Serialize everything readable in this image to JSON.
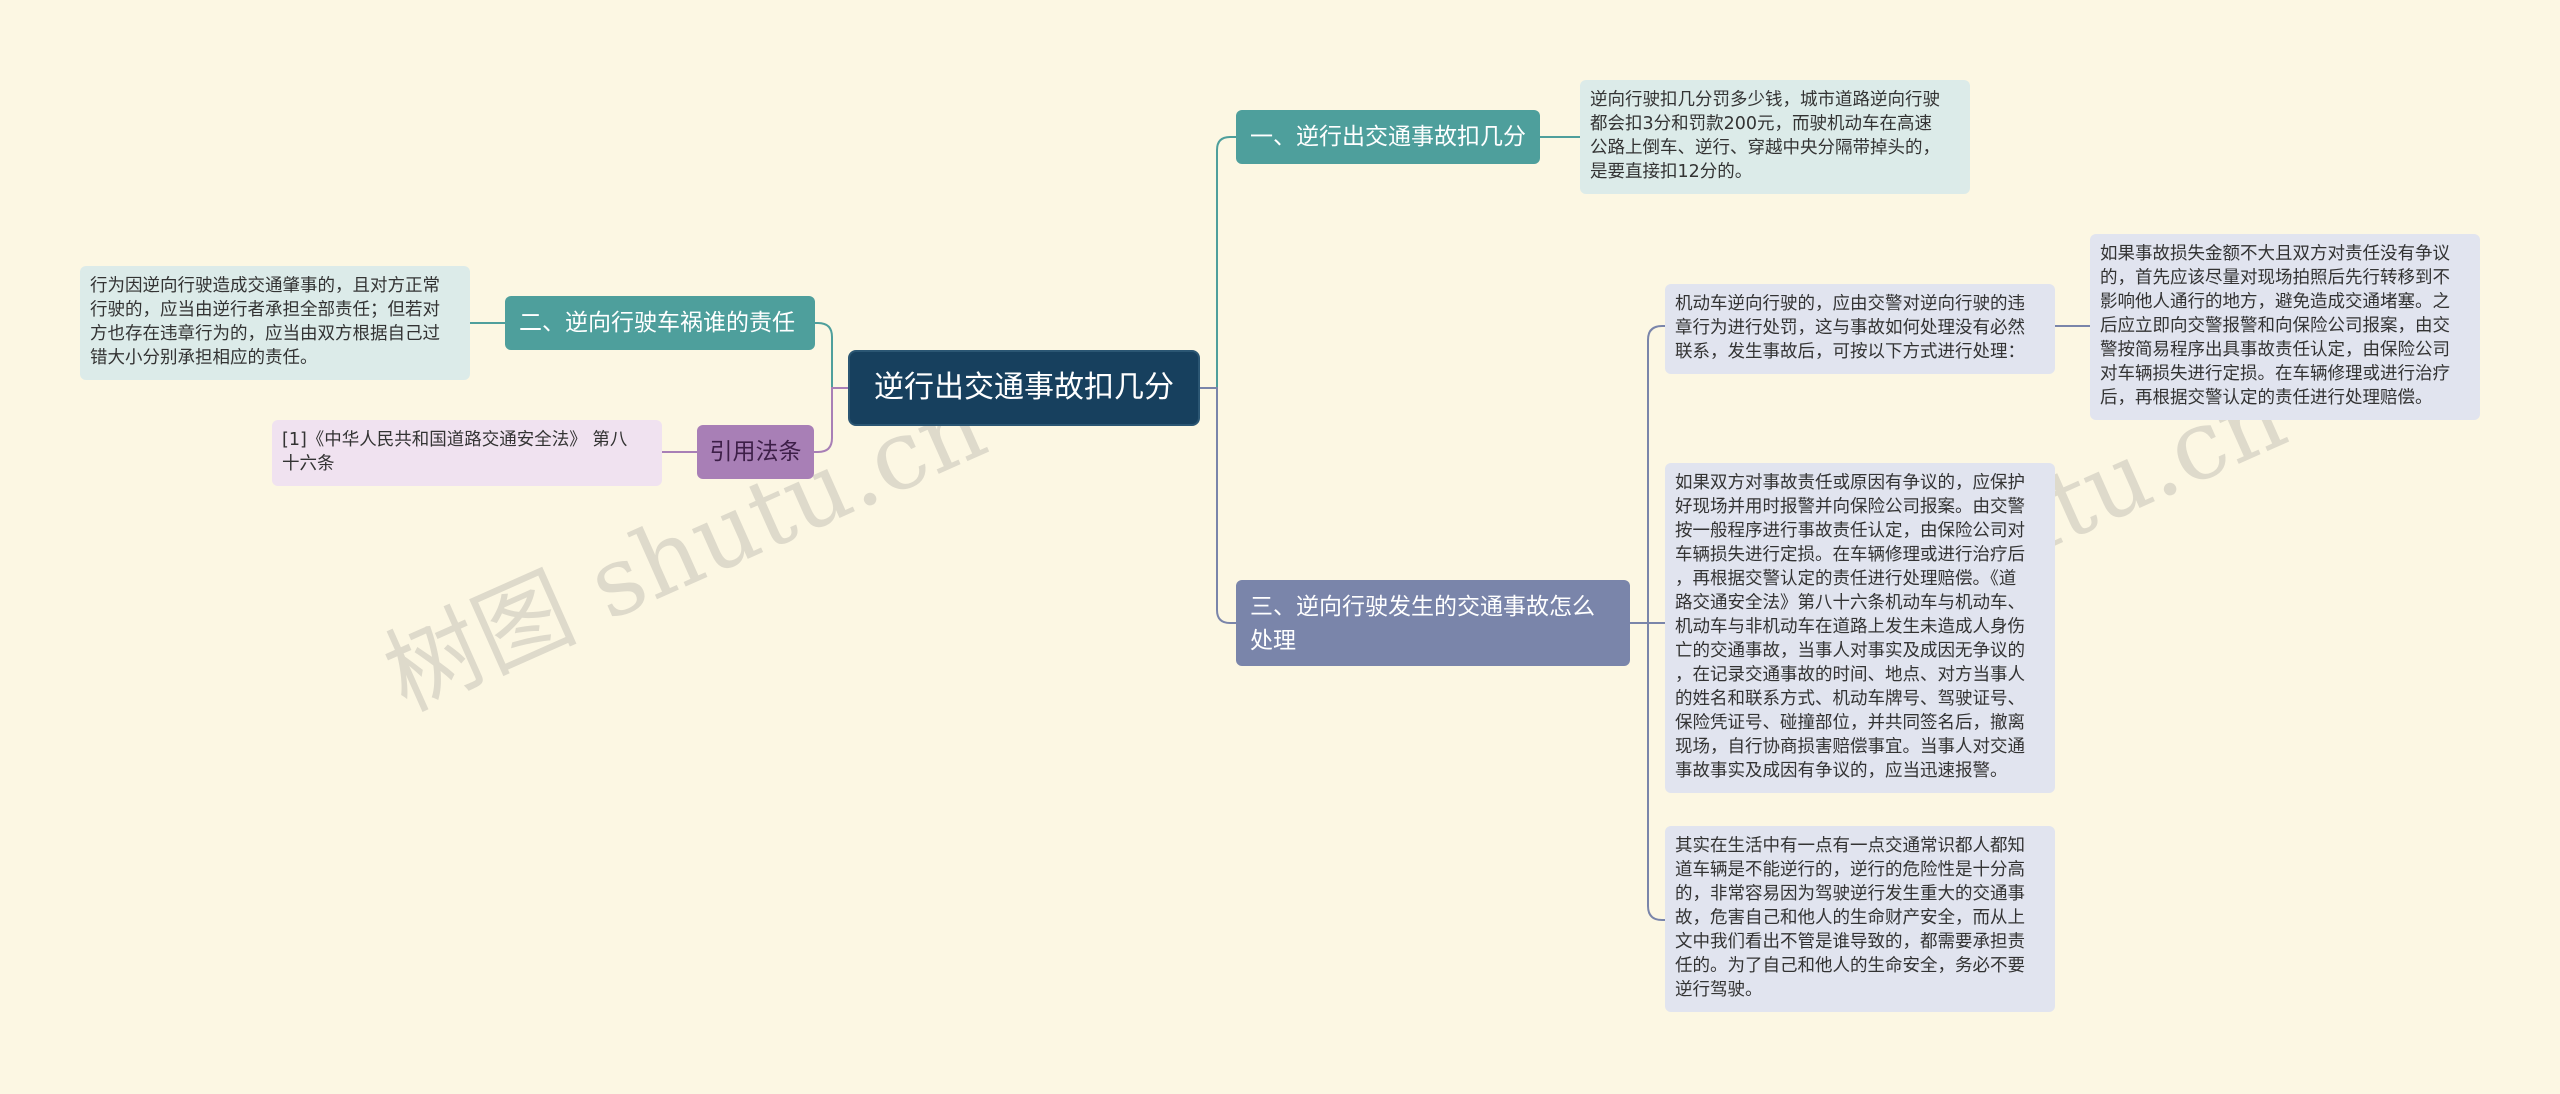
{
  "root": {
    "label": "逆行出交通事故扣几分"
  },
  "branches": {
    "b1": {
      "label": "一、逆行出交通事故扣几分"
    },
    "b2": {
      "label": "二、逆向行驶车祸谁的责任"
    },
    "b3": {
      "label": "三、逆向行驶发生的交通事故怎么\n处理"
    },
    "b4": {
      "label": "引用法条"
    }
  },
  "leaves": {
    "l1": {
      "text": "逆向行驶扣几分罚多少钱，城市道路逆向行驶\n都会扣3分和罚款200元，而驶机动车在高速\n公路上倒车、逆行、穿越中央分隔带掉头的，\n是要直接扣12分的。"
    },
    "l2": {
      "text": "行为因逆向行驶造成交通肇事的，且对方正常\n行驶的，应当由逆行者承担全部责任；但若对\n方也存在违章行为的，应当由双方根据自己过\n错大小分别承担相应的责任。"
    },
    "l3": {
      "text": "[1]《中华人民共和国道路交通安全法》 第八\n十六条"
    },
    "l4": {
      "text": "机动车逆向行驶的，应由交警对逆向行驶的违\n章行为进行处罚，这与事故如何处理没有必然\n联系，发生事故后，可按以下方式进行处理："
    },
    "l5": {
      "text": "如果事故损失金额不大且双方对责任没有争议\n的，首先应该尽量对现场拍照后先行转移到不\n影响他人通行的地方，避免造成交通堵塞。之\n后应立即向交警报警和向保险公司报案，由交\n警按简易程序出具事故责任认定，由保险公司\n对车辆损失进行定损。在车辆修理或进行治疗\n后，再根据交警认定的责任进行处理赔偿。"
    },
    "l6": {
      "text": "如果双方对事故责任或原因有争议的，应保护\n好现场并用时报警并向保险公司报案。由交警\n按一般程序进行事故责任认定，由保险公司对\n车辆损失进行定损。在车辆修理或进行治疗后\n，再根据交警认定的责任进行处理赔偿。《道\n路交通安全法》第八十六条机动车与机动车、\n机动车与非机动车在道路上发生未造成人身伤\n亡的交通事故，当事人对事实及成因无争议的\n，在记录交通事故的时间、地点、对方当事人\n的姓名和联系方式、机动车牌号、驾驶证号、\n保险凭证号、碰撞部位，并共同签名后，撤离\n现场，自行协商损害赔偿事宜。当事人对交通\n事故事实及成因有争议的，应当迅速报警。"
    },
    "l7": {
      "text": "其实在生活中有一点有一点交通常识都人都知\n道车辆是不能逆行的，逆行的危险性是十分高\n的，非常容易因为驾驶逆行发生重大的交通事\n故，危害自己和他人的生命财产安全，而从上\n文中我们看出不管是谁导致的，都需要承担责\n任的。为了自己和他人的生命安全，务必不要\n逆行驾驶。"
    }
  },
  "watermarks": [
    "树图 shutu.cn",
    "树图 shutu.cn"
  ],
  "colors": {
    "background": "#fcf7e3",
    "root": "#17405e",
    "teal_branch": "#4e9f9c",
    "slate_branch": "#7a85aa",
    "purple_branch": "#a87fb6",
    "teal_leaf": "#dcebe9",
    "slate_leaf": "#e1e4ef",
    "purple_leaf": "#f0e2f0"
  }
}
